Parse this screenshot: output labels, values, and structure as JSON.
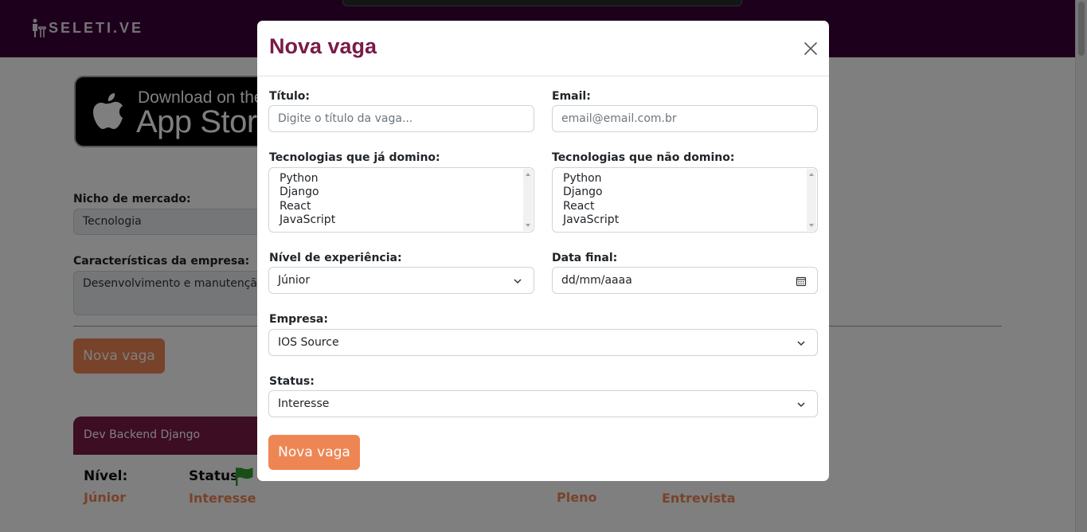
{
  "brand": {
    "logo_text": "SELETI.VE"
  },
  "appstore_badge": {
    "line1": "Download on the",
    "line2": "App Store"
  },
  "background_form": {
    "niche_label": "Nicho de mercado:",
    "niche_value": "Tecnologia",
    "features_label": "Características da empresa:",
    "features_value": "Desenvolvimento e manutenção de software",
    "new_job_button": "Nova vaga"
  },
  "job_cards": [
    {
      "title": "Dev Backend Django",
      "level_label": "Nível:",
      "level": "Júnior",
      "status_label": "Status",
      "status": "Interesse",
      "flag_color": "#2e9e2e"
    },
    {
      "title": "",
      "level_label": "",
      "level": "Pleno",
      "status_label": "",
      "status": "Entrevista",
      "flag_color": "#2e9e2e"
    }
  ],
  "modal": {
    "title": "Nova vaga",
    "fields": {
      "title_label": "Título:",
      "title_placeholder": "Digite o título da vaga...",
      "email_label": "Email:",
      "email_placeholder": "email@email.com.br",
      "known_tech_label": "Tecnologias que já domino:",
      "known_tech_options": [
        "Python",
        "Django",
        "React",
        "JavaScript"
      ],
      "unknown_tech_label": "Tecnologias que não domino:",
      "unknown_tech_options": [
        "Python",
        "Django",
        "React",
        "JavaScript"
      ],
      "experience_label": "Nível de experiência:",
      "experience_value": "Júnior",
      "end_date_label": "Data final:",
      "end_date_placeholder": "dd/mm/aaaa",
      "company_label": "Empresa:",
      "company_value": "IOS Source",
      "status_label": "Status:",
      "status_value": "Interesse"
    },
    "submit_label": "Nova vaga"
  },
  "colors": {
    "navbar": "#3b0037",
    "accent_orange": "#ee8654",
    "brand_wine": "#7a1a47"
  }
}
